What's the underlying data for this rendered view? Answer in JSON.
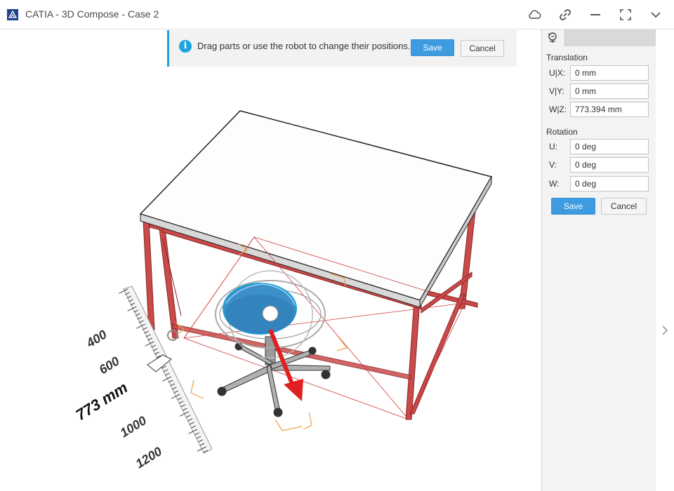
{
  "window": {
    "title": "CATIA - 3D Compose - Case 2",
    "icons": [
      "cloud-icon",
      "link-icon",
      "minimize-icon",
      "fullscreen-icon",
      "chevron-down-icon"
    ]
  },
  "info_bar": {
    "message": "Drag parts or use the robot to change their positions.",
    "save_label": "Save",
    "cancel_label": "Cancel"
  },
  "panel": {
    "translation_title": "Translation",
    "translation": [
      {
        "label": "U|X:",
        "value": "0 mm"
      },
      {
        "label": "V|Y:",
        "value": "0 mm"
      },
      {
        "label": "W|Z:",
        "value": "773.394 mm"
      }
    ],
    "rotation_title": "Rotation",
    "rotation": [
      {
        "label": "U:",
        "value": "0 deg"
      },
      {
        "label": "V:",
        "value": "0 deg"
      },
      {
        "label": "W:",
        "value": "0 deg"
      }
    ],
    "save_label": "Save",
    "cancel_label": "Cancel"
  },
  "ruler": {
    "labels": [
      "400",
      "600",
      "773 mm",
      "1000",
      "1200"
    ]
  },
  "colors": {
    "accent": "#1ba4e0",
    "primary_button": "#3e9be0",
    "frame": "#b23a3a",
    "selection": "#3c8fc8",
    "arrow": "#e02020"
  }
}
